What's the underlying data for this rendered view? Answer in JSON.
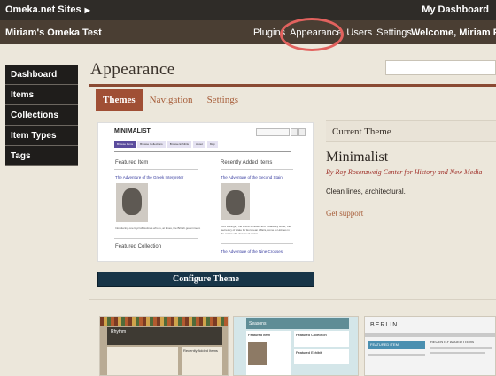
{
  "topbar": {
    "sites_label": "Omeka.net Sites",
    "dashboard_label": "My Dashboard"
  },
  "header": {
    "site_title": "Miriam's Omeka Test",
    "nav": [
      "Plugins",
      "Appearance",
      "Users",
      "Settings"
    ],
    "welcome": "Welcome, Miriam Po"
  },
  "sidebar": {
    "items": [
      "Dashboard",
      "Items",
      "Collections",
      "Item Types",
      "Tags"
    ]
  },
  "page": {
    "title": "Appearance"
  },
  "tabs": [
    {
      "label": "Themes",
      "active": true
    },
    {
      "label": "Navigation",
      "active": false
    },
    {
      "label": "Settings",
      "active": false
    }
  ],
  "preview": {
    "logo": "MINIMALIST",
    "nav": [
      "Browse Items",
      "Browse Collections",
      "Browse Exhibits",
      "About",
      "Map"
    ],
    "featured_item_heading": "Featured Item",
    "featured_item_link": "The Adventure of the Greek Interpreter",
    "featured_item_text": "Introducing one Mycroft Holmes who is, at times, the British government.",
    "recent_heading": "Recently Added Items",
    "recent_link": "The Adventure of the Second Stain",
    "recent_link2": "The Adventure of the Nine Crosses",
    "recent_text": "Lord Bellinger, the Prime Minister, and Trelawney Hope, the Secretary of State for European Affairs, come to Holmes in the matter of a document stolen...",
    "featured_collection_heading": "Featured Collection"
  },
  "configure_button": "Configure Theme",
  "current_theme": {
    "heading": "Current Theme",
    "name": "Minimalist",
    "author": "By Roy Rosenzweig Center for History and New Media",
    "description": "Clean lines, architectural.",
    "support_link": "Get support"
  },
  "thumbnails": {
    "rhythm_title": "Rhythm",
    "seasons_title": "Seasons",
    "berlin_title": "BERLIN",
    "berlin_recent": "RECENTLY ADDED ITEMS",
    "seasons_featured_item": "Featured Item",
    "seasons_featured_collection": "Featured Collection",
    "seasons_featured_exhibit": "Featured Exhibit",
    "berlin_featured": "FEATURED ITEM",
    "rhythm_recent": "Recently Added Items"
  },
  "colors": {
    "accent": "#a04f35",
    "highlight_ring": "#e2625e",
    "button": "#183548"
  }
}
